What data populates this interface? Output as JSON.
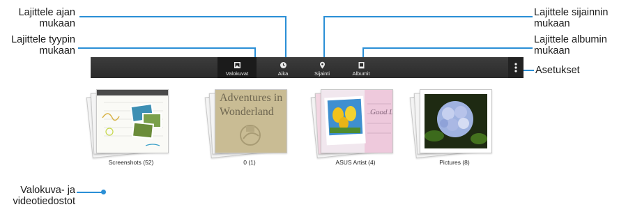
{
  "callouts": {
    "sort_by_time": "Lajittele ajan mukaan",
    "sort_by_type": "Lajittele tyypin mukaan",
    "sort_by_location": "Lajittele sijainnin mukaan",
    "sort_by_album": "Lajittele albumin mukaan",
    "settings": "Asetukset",
    "photo_video_files": "Valokuva- ja videotiedostot"
  },
  "actionbar": {
    "tabs": [
      {
        "label": "Valokuvat",
        "icon": "photo-icon"
      },
      {
        "label": "Aika",
        "icon": "clock-icon"
      },
      {
        "label": "Sijainti",
        "icon": "location-pin-icon"
      },
      {
        "label": "Albumit",
        "icon": "album-icon"
      }
    ],
    "overflow_icon": "overflow-menu-icon"
  },
  "albums": [
    {
      "caption": "Screenshots (52)",
      "thumb_text": ""
    },
    {
      "caption": "0 (1)",
      "thumb_text": "Adventures in Wonderland"
    },
    {
      "caption": "ASUS Artist (4)",
      "thumb_text": "Good Lu"
    },
    {
      "caption": "Pictures (8)",
      "thumb_text": ""
    }
  ],
  "colors": {
    "accent": "#2a8fd6",
    "actionbar": "#333333"
  }
}
